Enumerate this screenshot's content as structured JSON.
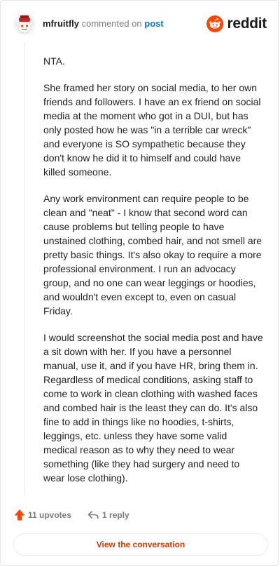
{
  "header": {
    "username": "mfruitfly",
    "action": "commented on",
    "post_link": "post",
    "brand": "reddit"
  },
  "comment": {
    "paragraphs": [
      "NTA.",
      "She framed her story on social media, to her own friends and followers. I have an ex friend on social media at the moment who got in a DUI, but has only posted how he was \"in a terrible car wreck\" and everyone is SO sympathetic because they don't know he did it to himself and could have killed someone.",
      "Any work environment can require people to be clean and \"neat\" - I know that second word can cause problems but telling people to have unstained clothing, combed hair, and not smell are pretty basic things. It's also okay to require a more professional environment. I run an advocacy group, and no one can wear leggings or hoodies, and wouldn't even except to, even on casual Friday.",
      "I would screenshot the social media post and have a sit down with her. If you have a personnel manual, use it, and if you have HR, bring them in. Regardless of medical conditions, asking staff to come to work in clean clothing with washed faces and combed hair is the least they can do. It's also fine to add in things like no hoodies, t-shirts, leggings, etc. unless they have some valid medical reason as to why they need to wear something (like they had surgery and need to wear lose clothing)."
    ]
  },
  "actions": {
    "upvotes": "11 upvotes",
    "replies": "1 reply"
  },
  "view_button": "View the conversation",
  "colors": {
    "accent": "#ff4500",
    "link": "#0079d3",
    "button_text": "#d93a00",
    "muted": "#7c7c7c"
  },
  "icons": {
    "avatar": "snoo-avatar",
    "brand": "reddit-logo-icon",
    "upvote": "upvote-arrow-icon",
    "reply": "reply-arrow-icon"
  }
}
